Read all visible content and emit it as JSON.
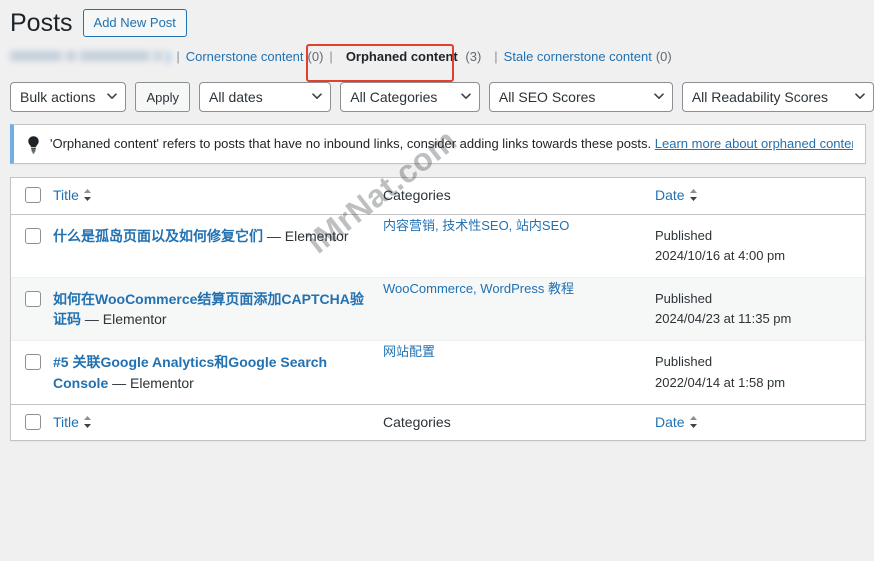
{
  "header": {
    "title": "Posts",
    "add_new_label": "Add New Post"
  },
  "views": {
    "blurred_label": ")",
    "separator": "|",
    "items": [
      {
        "label": "Cornerstone content",
        "count": "(0)",
        "current": false
      },
      {
        "label": "Orphaned content",
        "count": "(3)",
        "current": true
      },
      {
        "label": "Stale cornerstone content",
        "count": "(0)",
        "current": false
      }
    ],
    "highlight_color": "#e2402f"
  },
  "toolbar": {
    "bulk_actions": "Bulk actions",
    "apply_label": "Apply",
    "all_dates": "All dates",
    "all_categories": "All Categories",
    "all_seo_scores": "All SEO Scores",
    "all_readability_scores": "All Readability Scores"
  },
  "notice": {
    "icon": "lightbulb-icon",
    "text": "'Orphaned content' refers to posts that have no inbound links, consider adding links towards these posts. ",
    "link_label": "Learn more about orphaned content",
    "trailing": ".",
    "accent_color": "#72aee6"
  },
  "table": {
    "columns": {
      "title": "Title",
      "categories": "Categories",
      "date": "Date"
    },
    "rows": [
      {
        "title": "什么是孤岛页面以及如何修复它们",
        "title_suffix": " — Elementor",
        "categories": "内容营销, 技术性SEO, 站内SEO",
        "date_status": "Published",
        "date_value": "2024/10/16 at 4:00 pm"
      },
      {
        "title": "如何在WooCommerce结算页面添加CAPTCHA验证码",
        "title_suffix": " — Elementor",
        "categories": "WooCommerce, WordPress 教程",
        "date_status": "Published",
        "date_value": "2024/04/23 at 11:35 pm"
      },
      {
        "title": "#5 关联Google Analytics和Google Search Console",
        "title_suffix": " — Elementor",
        "categories": "网站配置",
        "date_status": "Published",
        "date_value": "2022/04/14 at 1:58 pm"
      }
    ]
  },
  "watermark": {
    "text": "iMrNat.com"
  }
}
